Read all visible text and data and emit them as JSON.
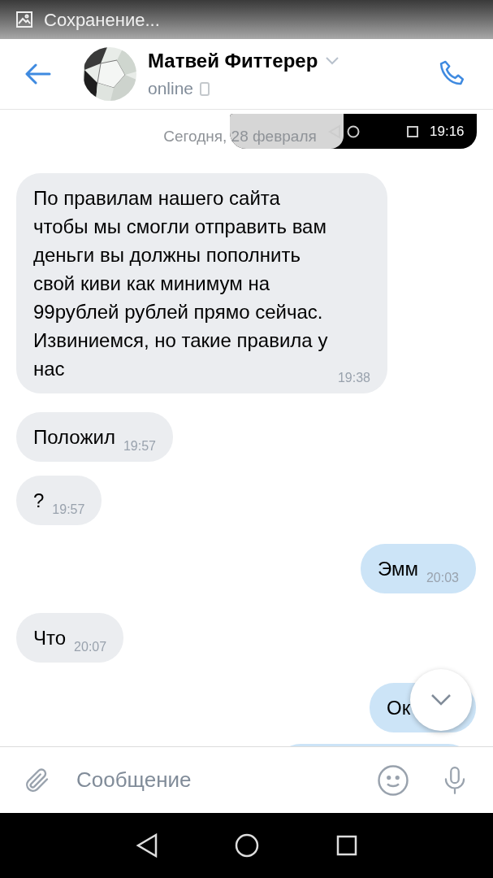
{
  "status_bar": {
    "text": "Сохранение..."
  },
  "header": {
    "name": "Матвей Фиттерер",
    "status": "online"
  },
  "date_divider": "Сегодня, 28 февраля",
  "overlay_bar": {
    "time": "19:16"
  },
  "messages": [
    {
      "outgoing": false,
      "text": "По правилам нашего сайта чтобы мы смогли отправить вам деньги вы должны пополнить свой киви как минимум на 99рублей рублей прямо сейчас. Извиниемся, но такие правила у нас",
      "time": "19:38"
    },
    {
      "outgoing": false,
      "text": "Положил",
      "time": "19:57"
    },
    {
      "outgoing": false,
      "text": "?",
      "time": "19:57"
    },
    {
      "outgoing": true,
      "text": "Эмм",
      "time": "20:03"
    },
    {
      "outgoing": false,
      "text": "Что",
      "time": "20:07"
    },
    {
      "outgoing": true,
      "text": "Ок"
    }
  ],
  "composer": {
    "placeholder": "Сообщение"
  }
}
